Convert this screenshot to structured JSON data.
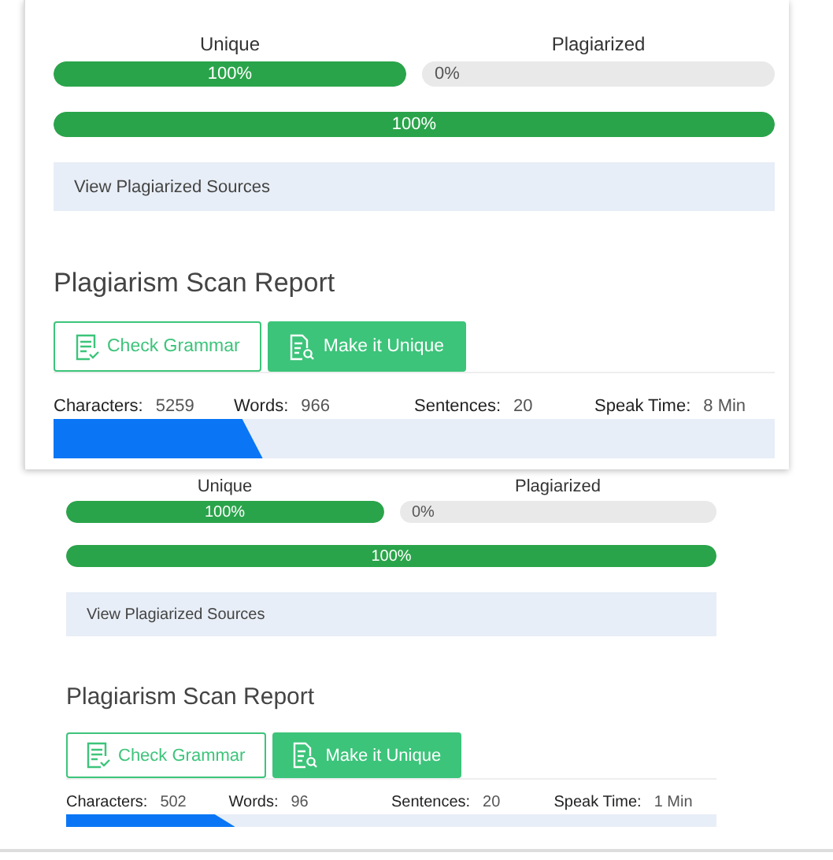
{
  "reports": [
    {
      "meters": [
        {
          "label": "Unique",
          "level": 1,
          "reading": "100%"
        },
        {
          "label": "Plagiarized",
          "reading": "0%"
        }
      ],
      "overall": {
        "level": 1,
        "reading": "100%"
      },
      "sources_link": "View Plagiarized Sources",
      "title": "Plagiarism Scan Report",
      "buttons": [
        {
          "label": "Check Grammar",
          "kind": "outline"
        },
        {
          "label": "Make it Unique",
          "kind": "solid"
        }
      ],
      "stats": [
        {
          "label": "Characters:",
          "value": "5259"
        },
        {
          "label": "Words:",
          "value": "966"
        },
        {
          "label": "Sentences:",
          "value": "20"
        },
        {
          "label": "Speak Time:",
          "value": "8 Min"
        }
      ],
      "tab_bar": {
        "level": 0.29
      }
    },
    {
      "meters": [
        {
          "label": "Unique",
          "level": 1,
          "reading": "100%"
        },
        {
          "label": "Plagiarized",
          "reading": "0%"
        }
      ],
      "overall": {
        "level": 1,
        "reading": "100%"
      },
      "sources_link": "View Plagiarized Sources",
      "title": "Plagiarism Scan Report",
      "buttons": [
        {
          "label": "Check Grammar",
          "kind": "outline"
        },
        {
          "label": "Make it Unique",
          "kind": "solid"
        }
      ],
      "stats": [
        {
          "label": "Characters:",
          "value": "502"
        },
        {
          "label": "Words:",
          "value": "96"
        },
        {
          "label": "Sentences:",
          "value": "20"
        },
        {
          "label": "Speak Time:",
          "value": "1 Min"
        }
      ],
      "tab_bar": {
        "level": 0.26
      }
    }
  ]
}
